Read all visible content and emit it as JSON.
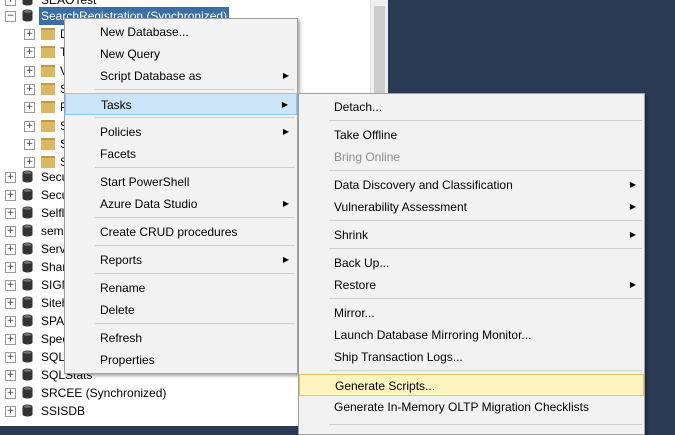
{
  "tree": {
    "top_partial": "SEAOTest",
    "selected_db": "SearchRegistration (Synchronized)",
    "folder_initials": [
      "D",
      "T",
      "V",
      "S",
      "P",
      "S",
      "S",
      "S"
    ],
    "databases": [
      "Secu",
      "Secu",
      "Selfl",
      "sem",
      "Serv",
      "Shar",
      "SIGM",
      "Siteh",
      "SPA",
      "Spec",
      "SQL",
      "SQLStats",
      "SRCEE (Synchronized)",
      "SSISDB"
    ]
  },
  "context_menu": {
    "items": [
      {
        "label": "New Database..."
      },
      {
        "label": "New Query"
      },
      {
        "label": "Script Database as"
      },
      {
        "label": "Tasks"
      },
      {
        "label": "Policies"
      },
      {
        "label": "Facets"
      },
      {
        "label": "Start PowerShell"
      },
      {
        "label": "Azure Data Studio"
      },
      {
        "label": "Create CRUD procedures"
      },
      {
        "label": "Reports"
      },
      {
        "label": "Rename"
      },
      {
        "label": "Delete"
      },
      {
        "label": "Refresh"
      },
      {
        "label": "Properties"
      }
    ]
  },
  "tasks_menu": {
    "items": [
      {
        "label": "Detach..."
      },
      {
        "label": "Take Offline"
      },
      {
        "label": "Bring Online"
      },
      {
        "label": "Data Discovery and Classification"
      },
      {
        "label": "Vulnerability Assessment"
      },
      {
        "label": "Shrink"
      },
      {
        "label": "Back Up..."
      },
      {
        "label": "Restore"
      },
      {
        "label": "Mirror..."
      },
      {
        "label": "Launch Database Mirroring Monitor..."
      },
      {
        "label": "Ship Transaction Logs..."
      },
      {
        "label": "Generate Scripts..."
      },
      {
        "label": "Generate In-Memory OLTP Migration Checklists"
      }
    ]
  },
  "colors": {
    "background": "#2b3a55",
    "selection": "#3a6ea5",
    "menu_hover": "#cce4f7",
    "submenu_hover": "#fdf4bf"
  }
}
